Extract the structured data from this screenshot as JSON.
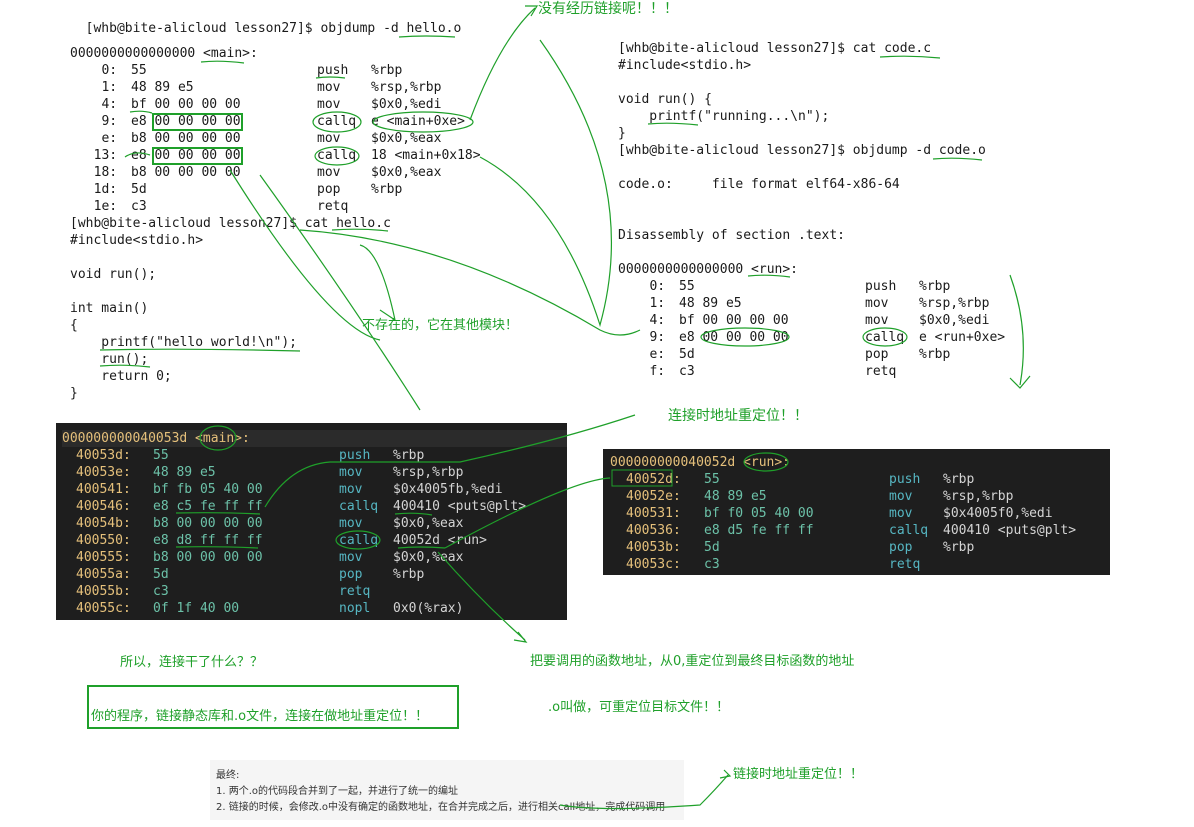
{
  "left_text": {
    "l1": "  [whb@bite-alicloud lesson27]$ objdump -d hello.o",
    "l2": "0000000000000000 <main>:",
    "rows": [
      {
        "off": "   0:",
        "bytes": "55",
        "mn": "push",
        "args": "%rbp"
      },
      {
        "off": "   1:",
        "bytes": "48 89 e5",
        "mn": "mov",
        "args": "%rsp,%rbp"
      },
      {
        "off": "   4:",
        "bytes": "bf 00 00 00 00",
        "mn": "mov",
        "args": "$0x0,%edi"
      },
      {
        "off": "   9:",
        "bytes": "e8 00 00 00 00",
        "mn": "callq",
        "args": "e <main+0xe>"
      },
      {
        "off": "   e:",
        "bytes": "b8 00 00 00 00",
        "mn": "mov",
        "args": "$0x0,%eax"
      },
      {
        "off": "  13:",
        "bytes": "e8 00 00 00 00",
        "mn": "callq",
        "args": "18 <main+0x18>"
      },
      {
        "off": "  18:",
        "bytes": "b8 00 00 00 00",
        "mn": "mov",
        "args": "$0x0,%eax"
      },
      {
        "off": "  1d:",
        "bytes": "5d",
        "mn": "pop",
        "args": "%rbp"
      },
      {
        "off": "  1e:",
        "bytes": "c3",
        "mn": "retq",
        "args": ""
      }
    ],
    "cat": "[whb@bite-alicloud lesson27]$ cat hello.c",
    "src": [
      "#include<stdio.h>",
      "",
      "void run();",
      "",
      "int main()",
      "{",
      "    printf(\"hello world!\\n\");",
      "    run();",
      "    return 0;",
      "}"
    ]
  },
  "right_text": {
    "cat": "[whb@bite-alicloud lesson27]$ cat code.c",
    "src": [
      "#include<stdio.h>",
      "",
      "void run() {",
      "    printf(\"running...\\n\");",
      "}"
    ],
    "objdump": "[whb@bite-alicloud lesson27]$ objdump -d code.o",
    "format": "code.o:     file format elf64-x86-64",
    "disasm": "Disassembly of section .text:",
    "label": "0000000000000000 <run>:",
    "rows": [
      {
        "off": "   0:",
        "bytes": "55",
        "mn": "push",
        "args": "%rbp"
      },
      {
        "off": "   1:",
        "bytes": "48 89 e5",
        "mn": "mov",
        "args": "%rsp,%rbp"
      },
      {
        "off": "   4:",
        "bytes": "bf 00 00 00 00",
        "mn": "mov",
        "args": "$0x0,%edi"
      },
      {
        "off": "   9:",
        "bytes": "e8 00 00 00 00",
        "mn": "callq",
        "args": "e <run+0xe>"
      },
      {
        "off": "   e:",
        "bytes": "5d",
        "mn": "pop",
        "args": "%rbp"
      },
      {
        "off": "   f:",
        "bytes": "c3",
        "mn": "retq",
        "args": ""
      }
    ]
  },
  "dark_left": {
    "header": "000000000040053d <main>:",
    "rows": [
      {
        "addr": "40053d:",
        "bytes": "55",
        "mn": "push",
        "args": "%rbp"
      },
      {
        "addr": "40053e:",
        "bytes": "48 89 e5",
        "mn": "mov",
        "args": "%rsp,%rbp"
      },
      {
        "addr": "400541:",
        "bytes": "bf fb 05 40 00",
        "mn": "mov",
        "args": "$0x4005fb,%edi"
      },
      {
        "addr": "400546:",
        "bytes": "e8 c5 fe ff ff",
        "mn": "callq",
        "args": "400410 <puts@plt>"
      },
      {
        "addr": "40054b:",
        "bytes": "b8 00 00 00 00",
        "mn": "mov",
        "args": "$0x0,%eax"
      },
      {
        "addr": "400550:",
        "bytes": "e8 d8 ff ff ff",
        "mn": "callq",
        "args": "40052d <run>"
      },
      {
        "addr": "400555:",
        "bytes": "b8 00 00 00 00",
        "mn": "mov",
        "args": "$0x0,%eax"
      },
      {
        "addr": "40055a:",
        "bytes": "5d",
        "mn": "pop",
        "args": "%rbp"
      },
      {
        "addr": "40055b:",
        "bytes": "c3",
        "mn": "retq",
        "args": ""
      },
      {
        "addr": "40055c:",
        "bytes": "0f 1f 40 00",
        "mn": "nopl",
        "args": "0x0(%rax)"
      }
    ]
  },
  "dark_right": {
    "header": "000000000040052d <run>:",
    "rows": [
      {
        "addr": "40052d:",
        "bytes": "55",
        "mn": "push",
        "args": "%rbp"
      },
      {
        "addr": "40052e:",
        "bytes": "48 89 e5",
        "mn": "mov",
        "args": "%rsp,%rbp"
      },
      {
        "addr": "400531:",
        "bytes": "bf f0 05 40 00",
        "mn": "mov",
        "args": "$0x4005f0,%edi"
      },
      {
        "addr": "400536:",
        "bytes": "e8 d5 fe ff ff",
        "mn": "callq",
        "args": "400410 <puts@plt>"
      },
      {
        "addr": "40053b:",
        "bytes": "5d",
        "mn": "pop",
        "args": "%rbp"
      },
      {
        "addr": "40053c:",
        "bytes": "c3",
        "mn": "retq",
        "args": ""
      }
    ]
  },
  "notes": {
    "no_link": "没有经历链接呢！！！",
    "not_exist": "不存在的，它在其他模块！",
    "reloc": "连接时地址重定位！！",
    "what": "所以，连接干了什么？？",
    "your_prog": "你的程序，链接静态库和.o文件，连接在做地址重定位！！",
    "call_addr": "把要调用的函数地址，从0,重定位到最终目标函数的地址",
    "o_file": ".o叫做，可重定位目标文件！！",
    "reloc2": "链接时地址重定位！！"
  },
  "final": {
    "title": "最终:",
    "item1": "1. 两个.o的代码段合并到了一起，并进行了统一的编址",
    "item2": "2. 链接的时候，会修改.o中没有确定的函数地址，在合并完成之后，进行相关call地址，完成代码调用"
  }
}
